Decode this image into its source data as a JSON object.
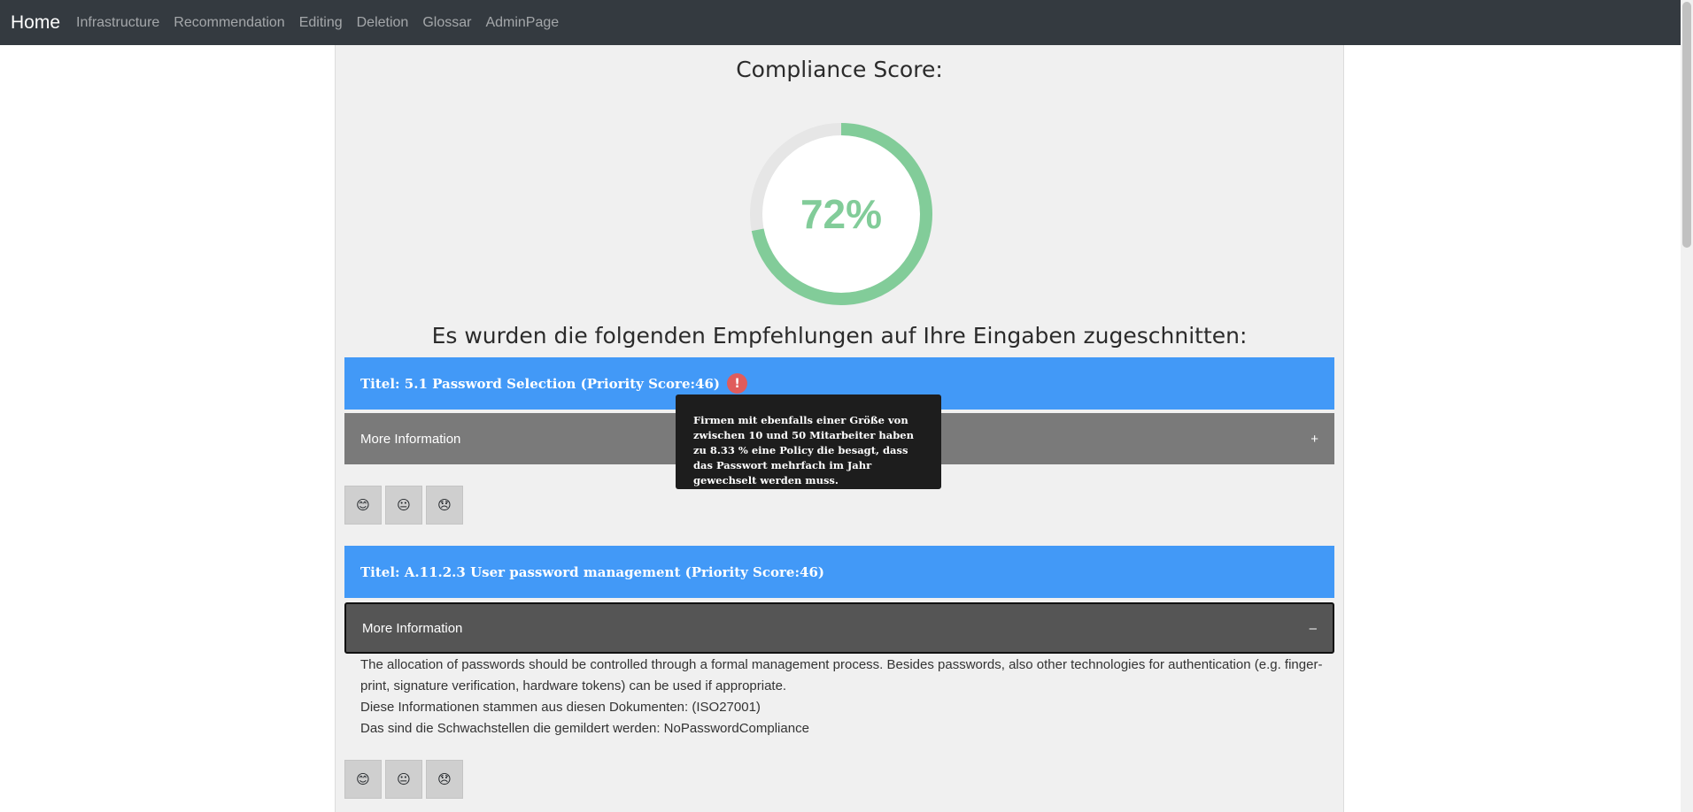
{
  "nav": {
    "brand": "Home",
    "links": [
      "Infrastructure",
      "Recommendation",
      "Editing",
      "Deletion",
      "Glossar",
      "AdminPage"
    ]
  },
  "score": {
    "heading": "Compliance Score:",
    "value_text": "72%",
    "value": 72,
    "color": "#82cc99"
  },
  "recommendations_heading": "Es wurden die folgenden Empfehlungen auf Ihre Eingaben zugeschnitten:",
  "recommendations": [
    {
      "title": "Titel: 5.1 Password Selection (Priority Score:46)",
      "alert_icon": "!",
      "more_label": "More Information",
      "toggle": "+"
    },
    {
      "title": "Titel: A.11.2.3 User password management (Priority Score:46)",
      "more_label": "More Information",
      "toggle": "–",
      "details": [
        "The allocation of passwords should be controlled through a formal management process. Besides passwords, also other technologies for authentication (e.g. finger-print, signature verification, hardware tokens) can be used if appropriate.",
        "Diese Informationen stammen aus diesen Dokumenten: (ISO27001)",
        "Das sind die Schwachstellen die gemildert werden: NoPasswordCompliance"
      ]
    }
  ],
  "feedback": [
    "😊",
    "😐",
    "😞"
  ],
  "tooltip": "Firmen mit ebenfalls einer Größe von zwischen 10 und 50 Mitarbeiter haben zu 8.33 % eine Policy die besagt, dass das Passwort mehrfach im Jahr gewechselt werden muss.",
  "colors": {
    "navbar": "#343a40",
    "title_bar": "#4299f7",
    "alert": "#e05c5c",
    "more_collapsed": "#7a7a7a",
    "more_expanded": "#555555"
  }
}
